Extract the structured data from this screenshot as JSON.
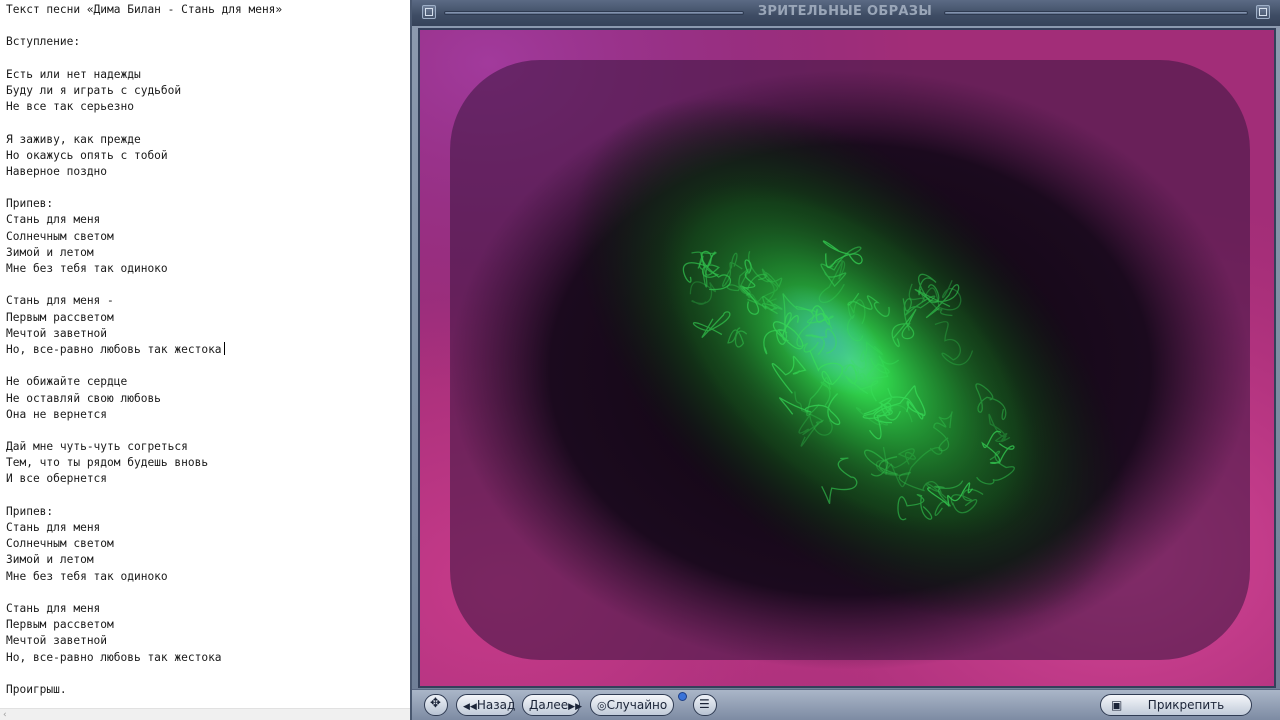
{
  "editor": {
    "lines": [
      "Текст песни «Дима Билан - Стань для меня»",
      "",
      "Вступление:",
      "",
      "Есть или нет надежды",
      "Буду ли я играть с судьбой",
      "Не все так серьезно",
      "",
      "Я заживу, как прежде",
      "Но окажусь опять с тобой",
      "Наверное поздно",
      "",
      "Припев:",
      "Стань для меня",
      "Солнечным светом",
      "Зимой и летом",
      "Мне без тебя так одиноко",
      "",
      "Стань для меня -",
      "Первым рассветом",
      "Мечтой заветной",
      "Но, все-равно любовь так жестока",
      "",
      "Не обижайте сердце",
      "Не оставляй свою любовь",
      "Она не вернется",
      "",
      "Дай мне чуть-чуть согреться",
      "Тем, что ты рядом будешь вновь",
      "И все обернется",
      "",
      "Припев:",
      "Стань для меня",
      "Солнечным светом",
      "Зимой и летом",
      "Мне без тебя так одиноко",
      "",
      "Стань для меня",
      "Первым рассветом",
      "Мечтой заветной",
      "Но, все-равно любовь так жестока",
      "",
      "Проигрыш."
    ],
    "caret_line": 21,
    "scroll_left_icon": "chevron-left-icon"
  },
  "visualizer": {
    "title": "ЗРИТЕЛЬНЫЕ ОБРАЗЫ",
    "colors": {
      "background": "#1a0820",
      "magenta": "#c2357f",
      "purple": "#8a2f8e",
      "dark": "#170818",
      "green": "#2dd246",
      "teal": "#2a8f8f"
    },
    "controls": {
      "move_icon": "move-arrows-icon",
      "back_label": "Назад",
      "next_label": "Далее",
      "random_label": "Случайно",
      "menu_icon": "list-menu-icon",
      "pin_label": "Прикрепить"
    }
  }
}
